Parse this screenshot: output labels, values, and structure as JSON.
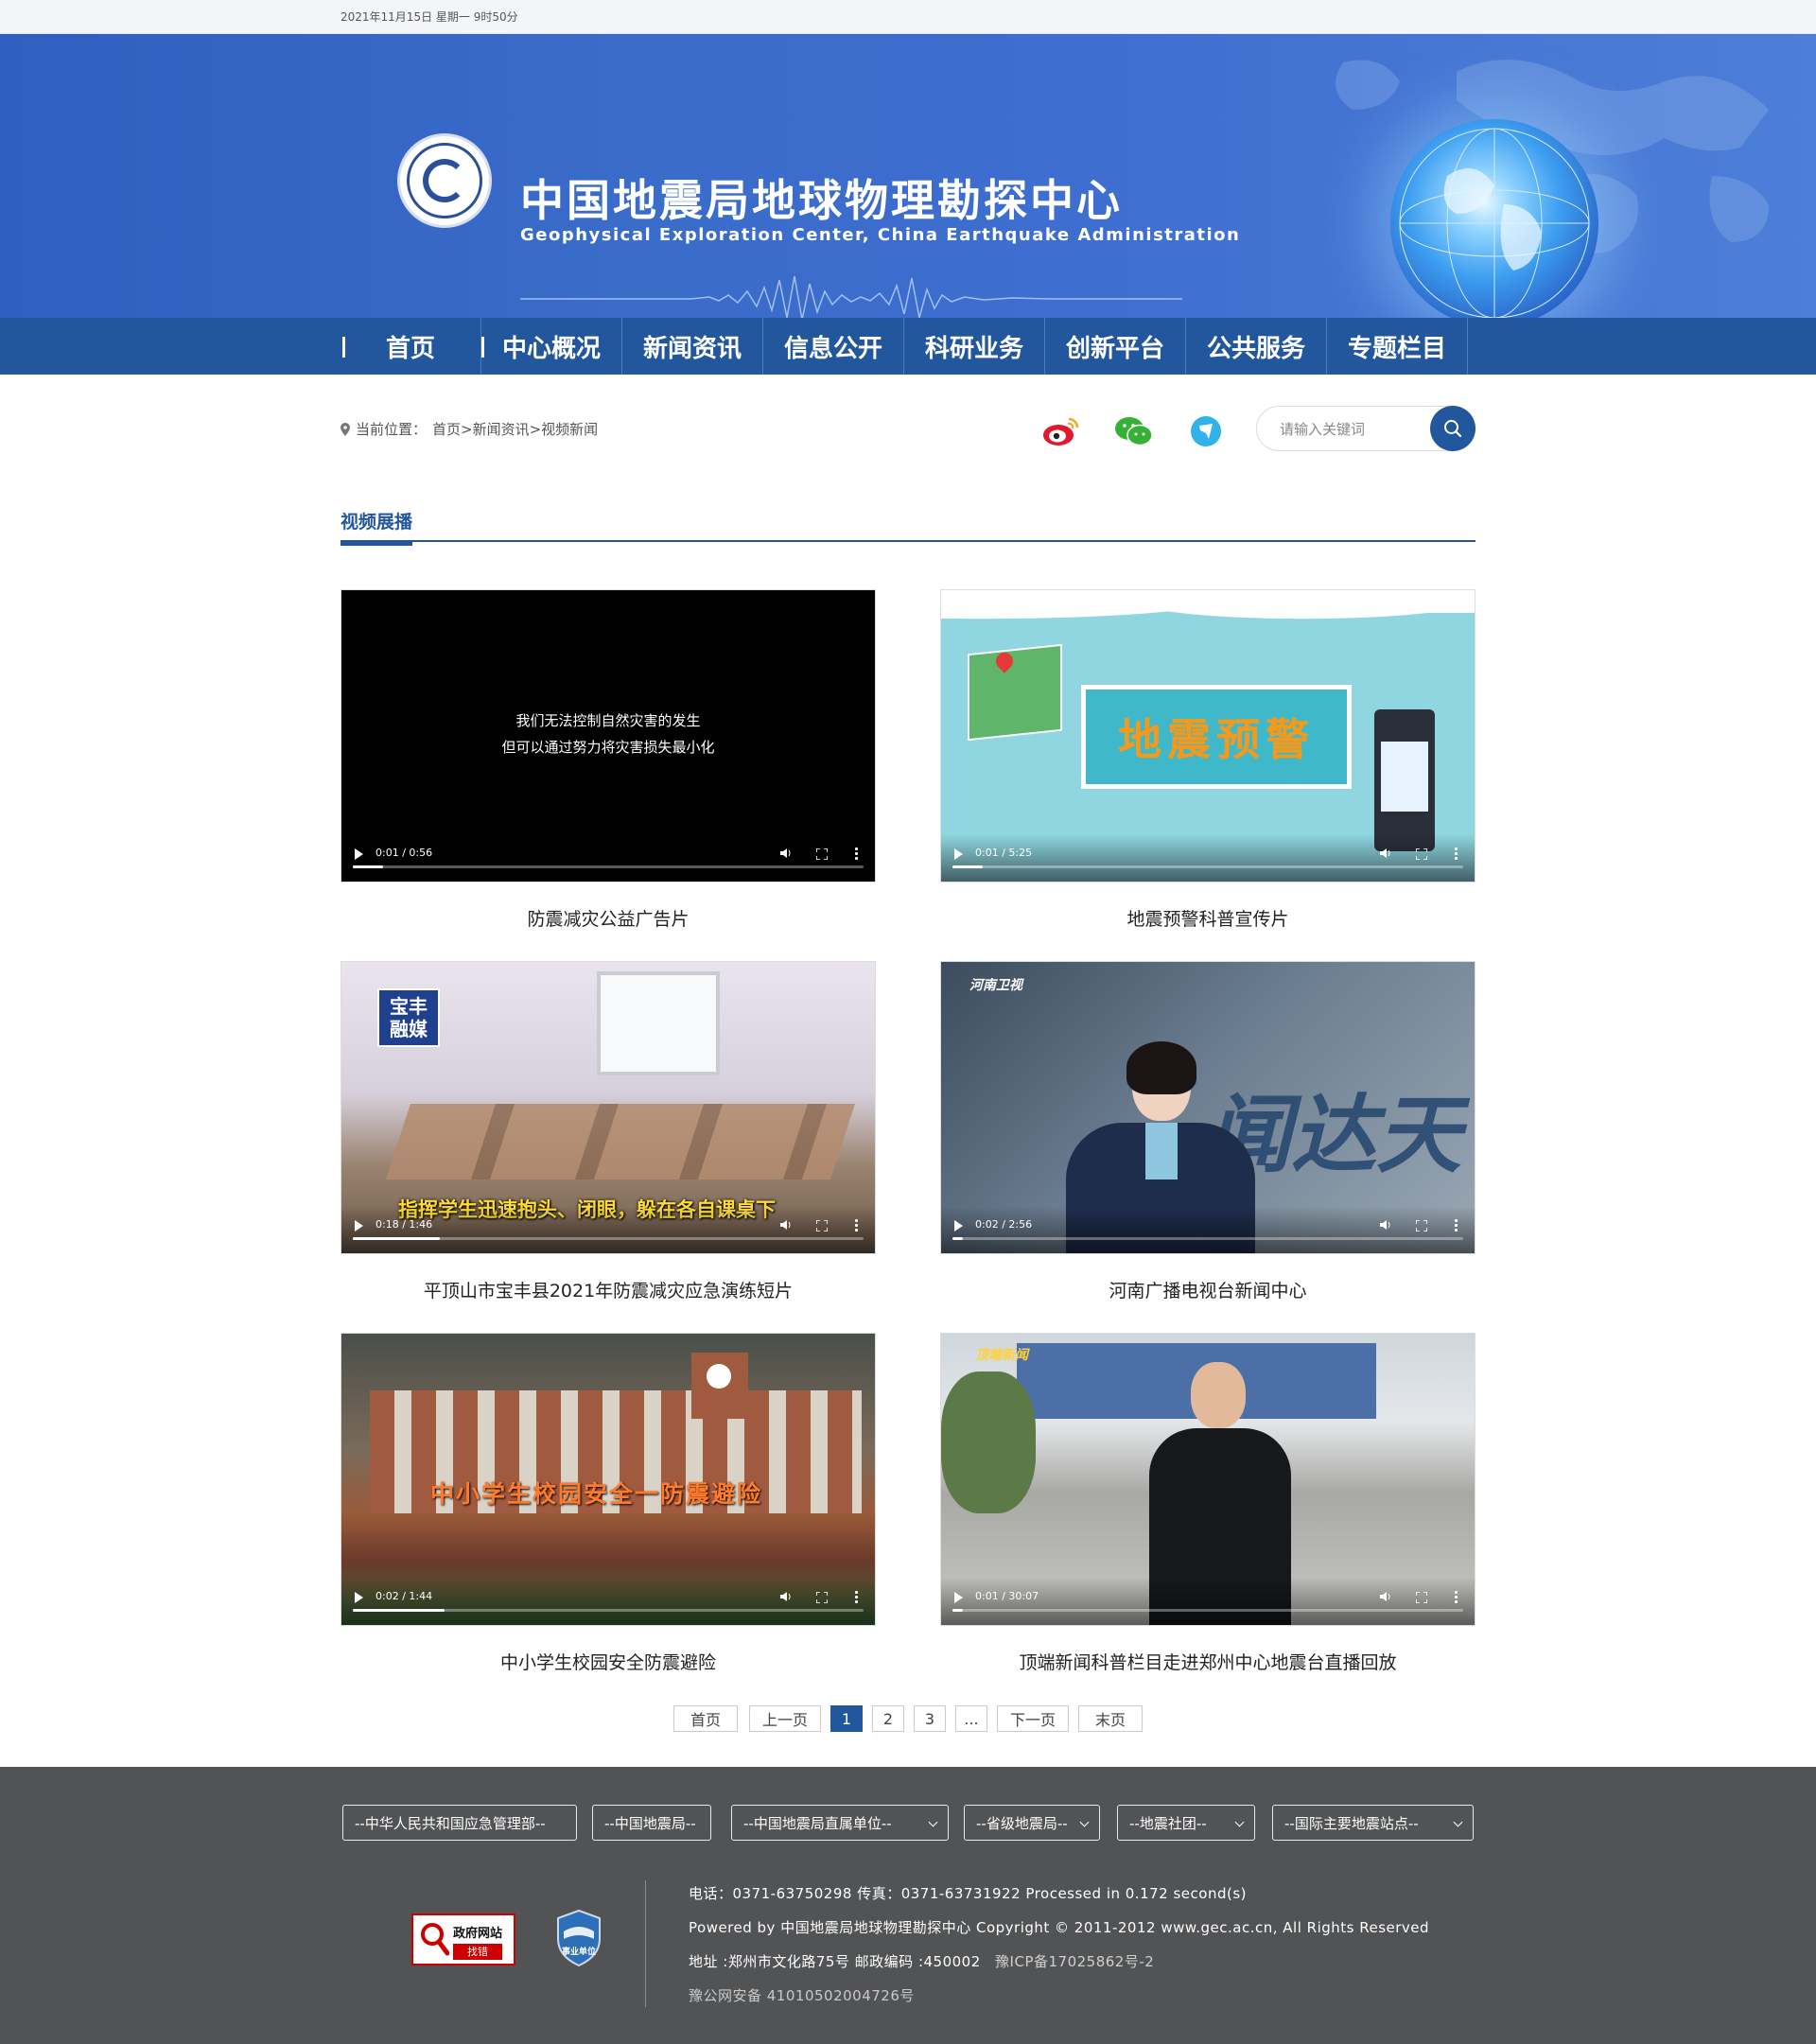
{
  "topbar": {
    "date": "2021年11月15日 星期一  9时50分"
  },
  "header": {
    "title": "中国地震局地球物理勘探中心",
    "subtitle": "Geophysical Exploration Center, China Earthquake Administration"
  },
  "nav": {
    "items": [
      {
        "label": "首页"
      },
      {
        "label": "中心概况"
      },
      {
        "label": "新闻资讯"
      },
      {
        "label": "信息公开"
      },
      {
        "label": "科研业务"
      },
      {
        "label": "创新平台"
      },
      {
        "label": "公共服务"
      },
      {
        "label": "专题栏目"
      }
    ]
  },
  "breadcrumb": {
    "prefix": "当前位置：",
    "path": "首页>新闻资讯>视频新闻"
  },
  "search": {
    "placeholder": "请输入关键词"
  },
  "icons": {
    "weibo": "weibo-icon",
    "wechat": "wechat-icon",
    "app": "app-icon",
    "search": "search-icon"
  },
  "section": {
    "title": "视频展播"
  },
  "videos": [
    {
      "caption": "防震减灾公益广告片",
      "time": "0:01 / 0:56",
      "progress": 0.06,
      "overlay_line1": "我们无法控制自然灾害的发生",
      "overlay_line2": "但可以通过努力将灾害损失最小化"
    },
    {
      "caption": "地震预警科普宣传片",
      "time": "0:01 / 5:25",
      "progress": 0.06,
      "banner_text": "地震预警"
    },
    {
      "caption": "平顶山市宝丰县2021年防震减灾应急演练短片",
      "time": "0:18 / 1:46",
      "progress": 0.17,
      "logo_text": "宝丰融媒",
      "subtitle_text": "指挥学生迅速抱头、闭眼，躲在各自课桌下"
    },
    {
      "caption": "河南广播电视台新闻中心",
      "time": "0:02 / 2:56",
      "progress": 0.02,
      "channel_text": "河南卫视",
      "bg_text": "闻达天"
    },
    {
      "caption": "中小学生校园安全防震避险",
      "time": "0:02 / 1:44",
      "progress": 0.18,
      "overlay_text": "中小学生校园安全一防震避险"
    },
    {
      "caption": "顶端新闻科普栏目走进郑州中心地震台直播回放",
      "time": "0:01 / 30:07",
      "progress": 0.02,
      "logo_text": "顶端新闻"
    }
  ],
  "pagination": {
    "first": "首页",
    "prev": "上一页",
    "pages": [
      "1",
      "2",
      "3"
    ],
    "current": "1",
    "ellipsis": "...",
    "next": "下一页",
    "last": "末页"
  },
  "footer": {
    "selects": [
      "--中华人民共和国应急管理部--",
      "--中国地震局--",
      "--中国地震局直属单位--",
      "--省级地震局--",
      "--地震社团--",
      "--国际主要地震站点--"
    ],
    "badge_gov_title": "政府网站",
    "badge_gov_action": "找错",
    "badge_unit": "事业单位",
    "phone_line": "电话：0371-63750298    传真：0371-63731922  Processed in 0.172 second(s)",
    "powered_line": "Powered by  中国地震局地球物理勘探中心  Copyright © 2011-2012 www.gec.ac.cn, All Rights Reserved",
    "address_line": "地址 :郑州市文化路75号  邮政编码 :450002",
    "icp": "豫ICP备17025862号-2",
    "police": "豫公网安备 41010502004726号"
  },
  "colors": {
    "brand": "#23579d",
    "banner": "#3a6cca",
    "footer": "#525355"
  }
}
